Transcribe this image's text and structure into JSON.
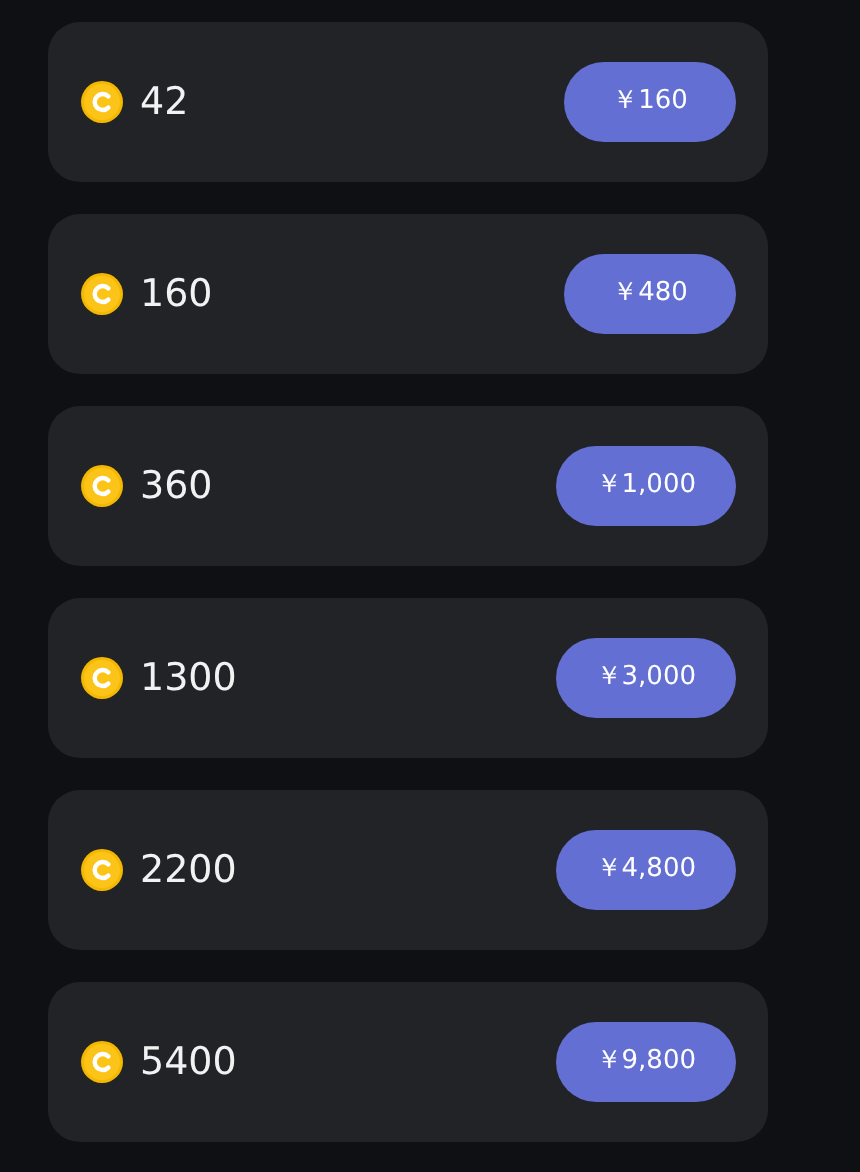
{
  "packages": [
    {
      "coins": "42",
      "price": "￥160"
    },
    {
      "coins": "160",
      "price": "￥480"
    },
    {
      "coins": "360",
      "price": "￥1,000"
    },
    {
      "coins": "1300",
      "price": "￥3,000"
    },
    {
      "coins": "2200",
      "price": "￥4,800"
    },
    {
      "coins": "5400",
      "price": "￥9,800"
    }
  ]
}
